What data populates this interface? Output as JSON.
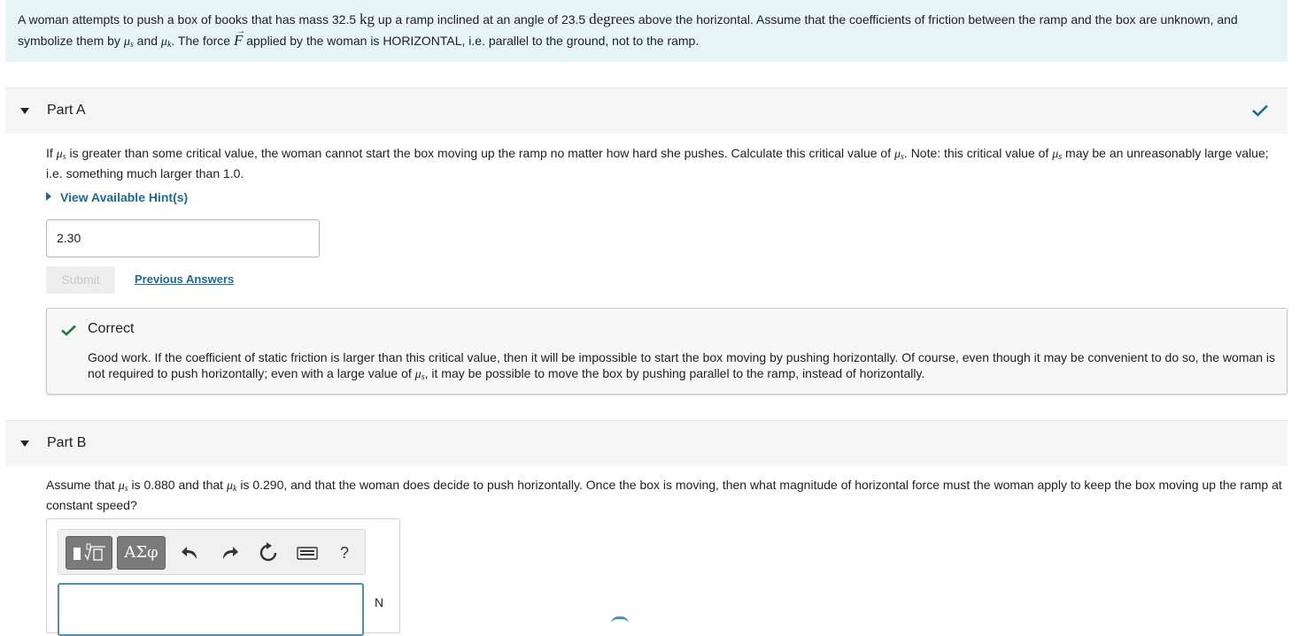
{
  "intro": {
    "t1": "A woman attempts to push a box of books that has mass ",
    "mass": "32.5",
    "mass_unit": "kg",
    "t2": " up a ramp inclined at an angle of ",
    "angle": "23.5",
    "angle_unit": "degrees",
    "t3": " above the horizontal. Assume that the coefficients of friction between the ramp and the box are unknown, and symbolize them by ",
    "t4": " and ",
    "t5": ". The force ",
    "force_symbol": "F",
    "t6": " applied by the woman is HORIZONTAL, i.e. parallel to the ground, not to the ramp."
  },
  "symbols": {
    "mu": "μ",
    "s": "s",
    "k": "k"
  },
  "part_a": {
    "title": "Part A",
    "q1": "If ",
    "q2": " is greater than some critical value, the woman cannot start the box moving up the ramp no matter how hard she pushes. Calculate this critical value of ",
    "q3": ". Note: this critical value of ",
    "q4": " may be an unreasonably large value; i.e. something much larger than 1.0.",
    "hints_label": "View Available Hint(s)",
    "answer_value": "2.30",
    "submit_label": "Submit",
    "previous_answers_label": "Previous Answers",
    "feedback": {
      "title": "Correct",
      "f1": "Good work. If the coefficient of static friction is larger than this critical value, then it will be impossible to start the box moving by pushing horizontally. Of course, even though it may be convenient to do so, the woman is not required to push horizontally; even with a large value of ",
      "f2": ", it may be possible to move the box by pushing parallel to the ramp, instead of horizontally."
    }
  },
  "part_b": {
    "title": "Part B",
    "q1": "Assume that ",
    "q2": " is 0.880 and that ",
    "q3": " is 0.290, and that the woman does decide to push horizontally. Once the box is moving, then what magnitude of horizontal force must the woman apply to keep the box moving up the ramp at constant speed?",
    "toolbar": {
      "greek_label": "ΑΣφ",
      "help_label": "?"
    },
    "unit": "N"
  },
  "colors": {
    "intro_bg": "#e6f4f5",
    "link": "#1d6b8f",
    "check": "#1e7b3a"
  }
}
